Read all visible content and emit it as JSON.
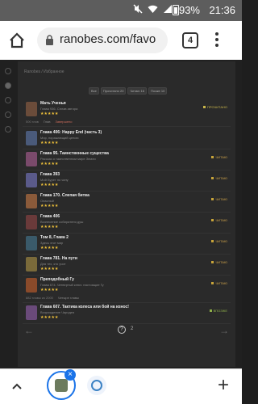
{
  "status_bar": {
    "battery_pct": "93%",
    "time": "21:36",
    "icons": [
      "mute-icon",
      "wifi-icon",
      "signal-icon",
      "battery-icon"
    ]
  },
  "browser": {
    "url": "ranobes.com/favo",
    "tab_count": "4"
  },
  "page": {
    "breadcrumb": "Ranobes / Избранное",
    "filters": [
      "Все",
      "Прочитано 20",
      "Читаю 16",
      "Позже 10"
    ],
    "items": [
      {
        "title": "Мать Ученья",
        "sub": "Глава 936. Сплав автора",
        "stars": "★★★★★",
        "status": "ПРОЧИТАНО",
        "status_class": "st-read",
        "cover": "#6b4c3a"
      },
      {
        "title": "Глава 406: Happy End (часть 3)",
        "sub": "Мир, поражающий ценою",
        "stars": "★★★★★",
        "status": "",
        "status_class": "",
        "cover": "#4a5a7a"
      },
      {
        "title": "Глава 95. Таинственные существа",
        "sub": "Рассказ о таинственном мире Земли",
        "stars": "★★★★★",
        "status": "ЧИТАЮ",
        "status_class": "st-reading",
        "cover": "#7a4a6b"
      },
      {
        "title": "Глава 393",
        "sub": "Мой Бурет по чипу",
        "stars": "★★★★★",
        "status": "ЧИТАЮ",
        "status_class": "st-reading",
        "cover": "#5a5a8a"
      },
      {
        "title": "Глава 170. Слепая битва",
        "sub": "Опасный",
        "stars": "★★★★★",
        "status": "ЧИТАЮ",
        "status_class": "st-reading",
        "cover": "#8a5a3a"
      },
      {
        "title": "Глава 406",
        "sub": "Вознесение собирателя душ",
        "stars": "★★★★★",
        "status": "ЧИТАЮ",
        "status_class": "st-reading",
        "cover": "#6a3a3a"
      },
      {
        "title": "Том 8, Глава 2",
        "sub": "Здесь этот мир",
        "stars": "★★★★★",
        "status": "ЧИТАЮ",
        "status_class": "st-reading",
        "cover": "#3a5a6a"
      },
      {
        "title": "Глава 781. На пути",
        "sub": "Для тех, кто учит",
        "stars": "★★★★★",
        "status": "ЧИТАЮ",
        "status_class": "st-reading",
        "cover": "#7a6a3a"
      },
      {
        "title": "Преподобный Гу",
        "sub": "Глава 674. Четвертый ключ: настоящие Гу",
        "stars": "★★★★★",
        "status": "ЧИТАЮ",
        "status_class": "st-reading",
        "cover": "#8a4a2a"
      },
      {
        "title": "Глава 607. Тактика колеса или бой на износ!",
        "sub": "Возрождение Чародея",
        "stars": "★★★★★",
        "status": "ВПОЗЖЕ",
        "status_class": "st-later",
        "cover": "#6a4a7a"
      }
    ],
    "meta_1": {
      "count": "500 глав",
      "link": "Глав",
      "warn": "Завершено"
    },
    "meta_2": {
      "count": "882 главы из 2000",
      "link": "Четыре главы"
    },
    "pager": {
      "prev": "←",
      "next": "→",
      "page": "2",
      "help": "?"
    }
  },
  "bottom": {
    "close_label": "×",
    "new_tab_label": "+"
  }
}
